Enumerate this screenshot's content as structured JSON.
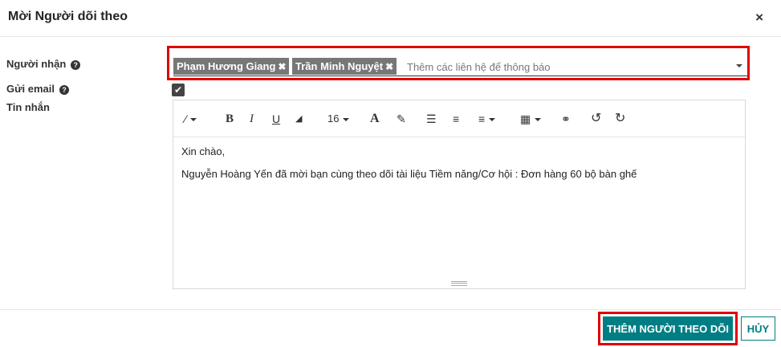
{
  "dialog": {
    "title": "Mời Người dõi theo",
    "close_glyph": "×"
  },
  "form": {
    "recipients_label": "Người nhận",
    "send_email_label": "Gửi email",
    "message_label": "Tin nhắn",
    "help_glyph": "?",
    "recipients": [
      {
        "name": "Phạm Hương Giang",
        "remove_glyph": "✖"
      },
      {
        "name": "Trần Minh Nguyệt",
        "remove_glyph": "✖"
      }
    ],
    "recipients_placeholder": "Thêm các liên hệ để thông báo",
    "send_email_checked": true,
    "checkmark_glyph": "✔"
  },
  "editor": {
    "toolbar": {
      "magic": "⁄",
      "bold": "B",
      "italic": "I",
      "underline": "U",
      "eraser": "◢",
      "font_size": "16",
      "font_color": "A",
      "brush": "✎",
      "bullet_list": "☰",
      "ordered_list": "≡",
      "align": "≡",
      "table": "▦",
      "link": "⚭",
      "undo": "↺",
      "redo": "↻"
    },
    "content": {
      "greeting": "Xin chào,",
      "body": "Nguyễn Hoàng Yến đã mời bạn cùng theo dõi tài liệu Tiềm năng/Cơ hội : Đơn hàng 60 bộ bàn ghế"
    }
  },
  "footer": {
    "add_followers_label": "THÊM NGƯỜI THEO DÕI",
    "cancel_label": "HỦY"
  },
  "colors": {
    "primary": "#017e84",
    "highlight": "#e00000",
    "tag_bg": "#777777"
  }
}
